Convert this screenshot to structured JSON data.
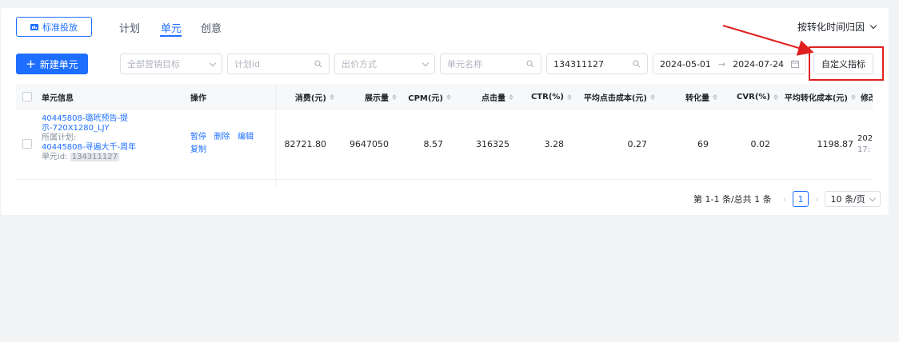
{
  "toolbar": {
    "standard_label": "标准投放",
    "attribution_label": "按转化时间归因"
  },
  "tabs": [
    {
      "label": "计划",
      "active": false
    },
    {
      "label": "单元",
      "active": true
    },
    {
      "label": "创意",
      "active": false
    }
  ],
  "actions": {
    "new_unit": "新建单元",
    "custom_metrics": "自定义指标"
  },
  "filters": {
    "marketing_goal": "全部营销目标",
    "plan_id": "计划id",
    "bid_method": "出价方式",
    "unit_name": "单元名称",
    "unit_id_value": "134311127",
    "date_start": "2024-05-01",
    "date_end": "2024-07-24"
  },
  "table": {
    "headers": {
      "unit_info": "单元信息",
      "ops": "操作",
      "cost": "消费(元)",
      "impressions": "展示量",
      "cpm": "CPM(元)",
      "clicks": "点击量",
      "ctr": "CTR(%)",
      "avg_click_cost": "平均点击成本(元)",
      "conversions": "转化量",
      "cvr": "CVR(%)",
      "avg_conv_cost": "平均转化成本(元)",
      "modified": "修改"
    },
    "row": {
      "unit_name_line1": "40445808-璐玳预告-提",
      "unit_name_line2": "示-720X1280_LJY",
      "plan_label": "所属计划:",
      "plan_name": "40445808-寻遍大千-周年",
      "unit_id_label": "单元id:",
      "unit_id": "134311127",
      "op_pause": "暂停",
      "op_delete": "删除",
      "op_edit": "编辑",
      "op_copy": "复制",
      "cost": "82721.80",
      "impressions": "9647050",
      "cpm": "8.57",
      "clicks": "316325",
      "ctr": "3.28",
      "avg_click_cost": "0.27",
      "conversions": "69",
      "cvr": "0.02",
      "avg_conv_cost": "1198.87",
      "modified_line1": "202",
      "modified_line2": "17:"
    }
  },
  "pagination": {
    "summary": "第 1-1 条/总共 1 条",
    "current_page": "1",
    "page_size": "10 条/页"
  },
  "colors": {
    "accent": "#1e6fff",
    "annotation": "#e02020"
  }
}
